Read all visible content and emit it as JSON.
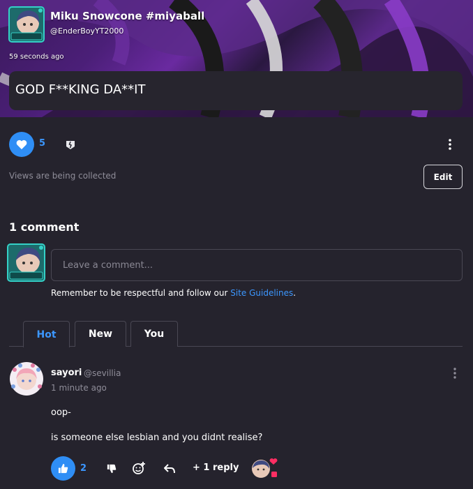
{
  "post": {
    "author_name": "Miku Snowcone #miyaball",
    "author_handle": "@EnderBoyYT2000",
    "time": "59 seconds ago",
    "text": "GOD F**KING DA**IT",
    "like_count": "5",
    "views_text": "Views are being collected",
    "edit_label": "Edit"
  },
  "comments_section": {
    "count_label": "1 comment",
    "input_placeholder": "Leave a comment...",
    "guidelines_prefix": "Remember to be respectful and follow our ",
    "guidelines_link": "Site Guidelines",
    "guidelines_suffix": ".",
    "tabs": [
      {
        "label": "Hot",
        "active": true
      },
      {
        "label": "New",
        "active": false
      },
      {
        "label": "You",
        "active": false
      }
    ]
  },
  "comment": {
    "name": "sayori",
    "handle": "@sevillia",
    "time": "1 minute ago",
    "line1": "oop-",
    "line2": "is someone else lesbian and you didnt realise?",
    "like_count": "2",
    "replies_label": "+ 1 reply"
  },
  "colors": {
    "accent": "#2f8ef5",
    "background": "#25232d",
    "link": "#3c97ff"
  },
  "icons": {
    "like": "thumbs-up-icon",
    "dislike": "thumbs-down-icon",
    "more": "vertical-dots-icon",
    "react": "add-reaction-icon",
    "reply": "reply-arrow-icon"
  }
}
